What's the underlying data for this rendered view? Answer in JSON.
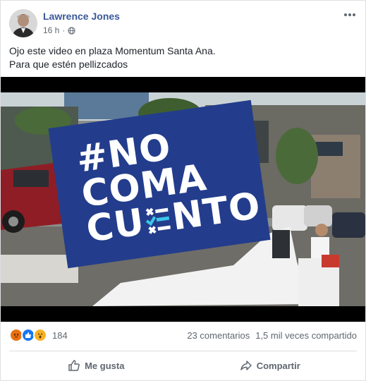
{
  "post": {
    "author": "Lawrence Jones",
    "time": "16 h",
    "separator": "·",
    "privacy_icon": "globe-icon",
    "lines": [
      "Ojo este video en plaza Momentum Santa Ana.",
      "Para que estén pellizcados"
    ]
  },
  "media": {
    "overlay_lines": [
      "#NO",
      "COMA",
      "CU",
      "NTO"
    ],
    "overlay_colors": {
      "panel": "#233d8c",
      "text": "#ffffff",
      "check": "#3cc6e8"
    }
  },
  "stats": {
    "reaction_icons": [
      "angry-icon",
      "like-icon",
      "wow-icon"
    ],
    "reaction_count": "184",
    "comments": "23 comentarios",
    "shares": "1,5 mil veces compartido"
  },
  "actions": {
    "like_label": "Me gusta",
    "share_label": "Compartir"
  },
  "colors": {
    "author": "#385898",
    "text": "#1d2129",
    "muted": "#606770"
  }
}
